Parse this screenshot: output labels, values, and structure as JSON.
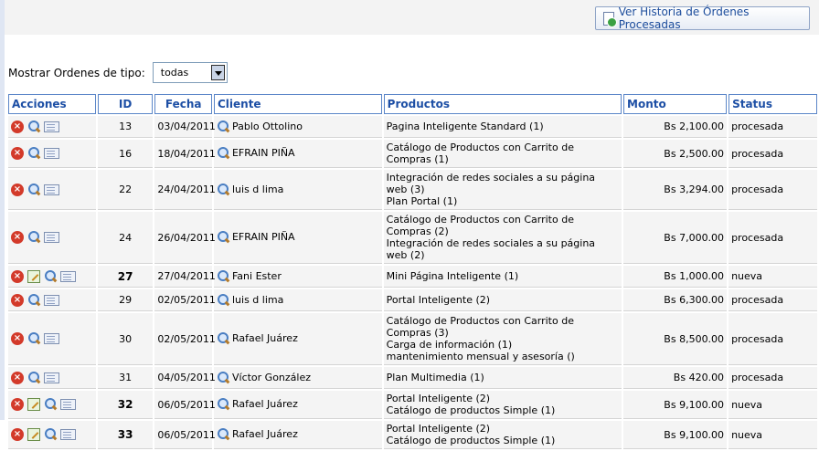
{
  "toolbar": {
    "history_button": "Ver Historia de Órdenes Procesadas"
  },
  "filter": {
    "label": "Mostrar Ordenes de tipo:",
    "selected": "todas"
  },
  "table": {
    "headers": {
      "acciones": "Acciones",
      "id": "ID",
      "fecha": "Fecha",
      "cliente": "Cliente",
      "productos": "Productos",
      "monto": "Monto",
      "status": "Status"
    },
    "rows": [
      {
        "id": "13",
        "fecha": "03/04/2011",
        "cliente": "Pablo Ottolino",
        "productos": [
          "Pagina Inteligente Standard (1)"
        ],
        "monto": "Bs 2,100.00",
        "status": "procesada",
        "editable": false
      },
      {
        "id": "16",
        "fecha": "18/04/2011",
        "cliente": "EFRAIN PIÑA",
        "productos": [
          "Catálogo de Productos con Carrito de Compras (1)"
        ],
        "monto": "Bs 2,500.00",
        "status": "procesada",
        "editable": false
      },
      {
        "id": "22",
        "fecha": "24/04/2011",
        "cliente": "luis d lima",
        "productos": [
          "Integración de redes sociales a su página web (3)",
          "Plan Portal (1)"
        ],
        "monto": "Bs 3,294.00",
        "status": "procesada",
        "editable": false
      },
      {
        "id": "24",
        "fecha": "26/04/2011",
        "cliente": "EFRAIN PIÑA",
        "productos": [
          "Catálogo de Productos con Carrito de Compras (2)",
          "Integración de redes sociales a su página web (2)"
        ],
        "monto": "Bs 7,000.00",
        "status": "procesada",
        "editable": false
      },
      {
        "id": "27",
        "fecha": "27/04/2011",
        "cliente": "Fani Ester",
        "productos": [
          "Mini Página Inteligente (1)"
        ],
        "monto": "Bs 1,000.00",
        "status": "nueva",
        "editable": true
      },
      {
        "id": "29",
        "fecha": "02/05/2011",
        "cliente": "luis d lima",
        "productos": [
          "Portal Inteligente (2)"
        ],
        "monto": "Bs 6,300.00",
        "status": "procesada",
        "editable": false
      },
      {
        "id": "30",
        "fecha": "02/05/2011",
        "cliente": "Rafael Juárez",
        "productos": [
          "Catálogo de Productos con Carrito de Compras (3)",
          "Carga de información (1)",
          "mantenimiento mensual y asesoría ()"
        ],
        "monto": "Bs 8,500.00",
        "status": "procesada",
        "editable": false
      },
      {
        "id": "31",
        "fecha": "04/05/2011",
        "cliente": "Víctor González",
        "productos": [
          "Plan Multimedia (1)"
        ],
        "monto": "Bs 420.00",
        "status": "procesada",
        "editable": false
      },
      {
        "id": "32",
        "fecha": "06/05/2011",
        "cliente": "Rafael Juárez",
        "productos": [
          "Portal Inteligente (2)",
          "Catálogo de productos Simple (1)"
        ],
        "monto": "Bs 9,100.00",
        "status": "nueva",
        "editable": true
      },
      {
        "id": "33",
        "fecha": "06/05/2011",
        "cliente": "Rafael Juárez",
        "productos": [
          "Portal Inteligente (2)",
          "Catálogo de productos Simple (1)"
        ],
        "monto": "Bs 9,100.00",
        "status": "nueva",
        "editable": true
      }
    ]
  }
}
